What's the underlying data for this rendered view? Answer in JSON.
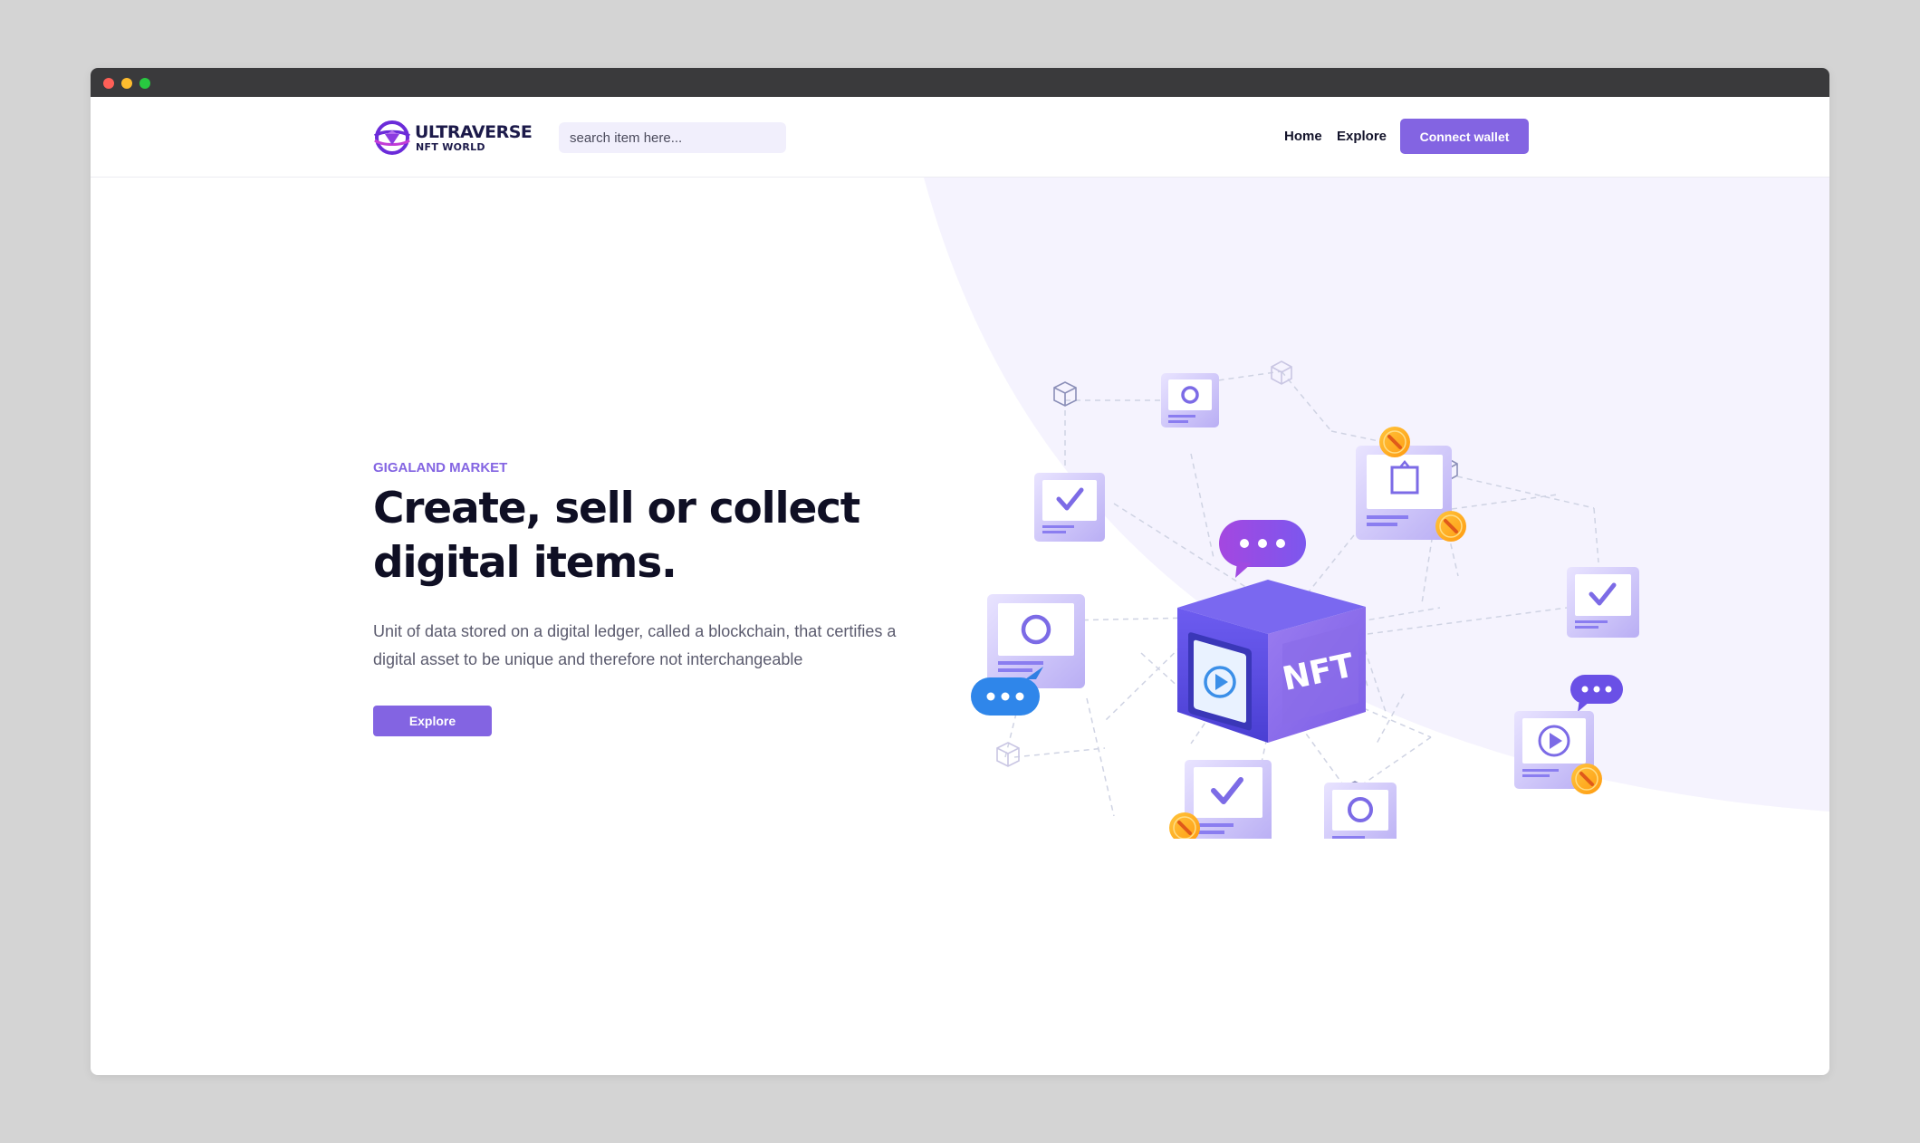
{
  "window": {
    "controls": [
      "close",
      "minimize",
      "maximize"
    ]
  },
  "navbar": {
    "logo": {
      "title": "ULTRAVERSE",
      "subtitle": "NFT WORLD",
      "icon": "ultraverse-logo-icon"
    },
    "search": {
      "placeholder": "search item here..."
    },
    "links": [
      {
        "label": "Home"
      },
      {
        "label": "Explore"
      }
    ],
    "connect_label": "Connect wallet"
  },
  "hero": {
    "eyebrow": "GIGALAND MARKET",
    "headline": "Create, sell or collect digital items.",
    "description": "Unit of data stored on a digital ledger, called a blockchain, that certifies a digital asset to be unique and therefore not interchangeable",
    "cta_label": "Explore"
  },
  "illustration": {
    "center_label": "NFT",
    "icons": [
      "nft-cube-icon",
      "chat-bubble-icon",
      "checkmark-card-icon",
      "circle-card-icon",
      "play-card-icon",
      "link-coin-icon",
      "wireframe-cube-icon",
      "frame-card-icon"
    ]
  },
  "colors": {
    "accent": "#8364e2",
    "heading": "#0f0f24",
    "body_text": "#5b5b6e",
    "hero_bg_shape": "#f5f3fe",
    "titlebar": "#3a3a3c",
    "page_bg": "#d4d4d4"
  }
}
